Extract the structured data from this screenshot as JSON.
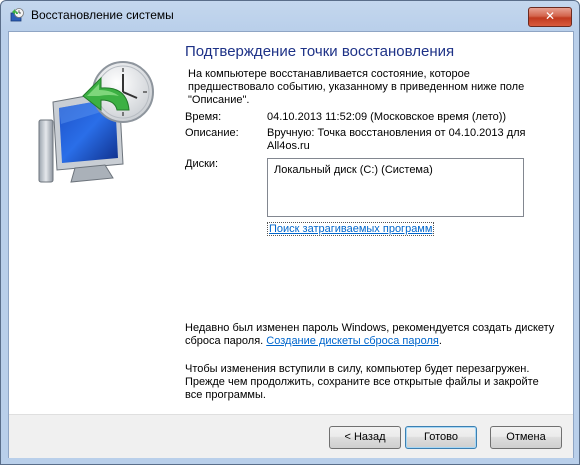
{
  "window": {
    "title": "Восстановление системы",
    "close_label": "✕"
  },
  "main": {
    "heading": "Подтверждение точки восстановления",
    "intro": "На компьютере восстанавливается состояние, которое предшествовало событию, указанному в приведенном ниже поле \"Описание\".",
    "time_label": "Время:",
    "time_value": "04.10.2013 11:52:09 (Московское время (лето))",
    "description_label": "Описание:",
    "description_value": "Вручную: Точка восстановления от 04.10.2013 для All4os.ru",
    "disks_label": "Диски:",
    "disks": [
      "Локальный диск (C:) (Система)"
    ],
    "scan_link": "Поиск затрагиваемых программ",
    "password_note": "Недавно был изменен пароль Windows, рекомендуется создать дискету сброса пароля.",
    "password_link": "Создание дискеты сброса пароля",
    "password_suffix": ".",
    "restart_note": "Чтобы изменения вступили в силу, компьютер будет перезагружен. Прежде чем продолжить, сохраните все открытые файлы и закройте все программы."
  },
  "buttons": {
    "back": "< Назад",
    "finish": "Готово",
    "cancel": "Отмена"
  },
  "icons": {
    "title": "system-restore-icon",
    "hero": "system-restore-clock-monitor-icon"
  },
  "colors": {
    "heading": "#1e3287",
    "link": "#0066cc",
    "close": "#c13a1f"
  }
}
